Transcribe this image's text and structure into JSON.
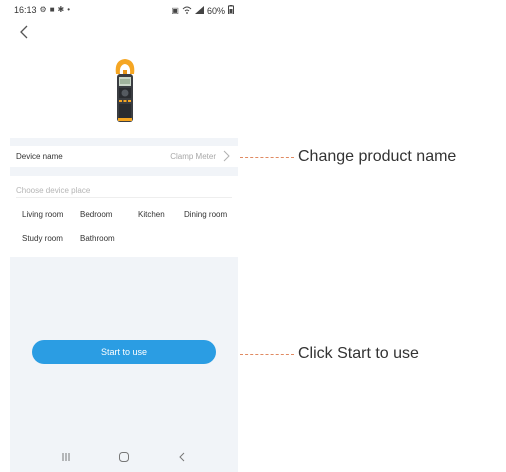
{
  "status_bar": {
    "time": "16:13",
    "battery": "60%"
  },
  "header": {
    "back_icon": "chevron-left-icon"
  },
  "device": {
    "name_label": "Device name",
    "name_value": "Clamp Meter",
    "image_icon": "clamp-meter-icon"
  },
  "place": {
    "title": "Choose device place",
    "rooms": [
      "Living room",
      "Bedroom",
      "Kitchen",
      "Dining room",
      "Study room",
      "Bathroom"
    ]
  },
  "actions": {
    "start_label": "Start to use"
  },
  "nav": {
    "icons": [
      "recent-apps-icon",
      "home-icon",
      "back-icon"
    ]
  },
  "annotations": {
    "change_name": "Change product name",
    "click_start": "Click Start to use"
  },
  "colors": {
    "accent": "#2b9de3",
    "panel": "#f1f4f8",
    "callout_line": "#e08a62"
  }
}
